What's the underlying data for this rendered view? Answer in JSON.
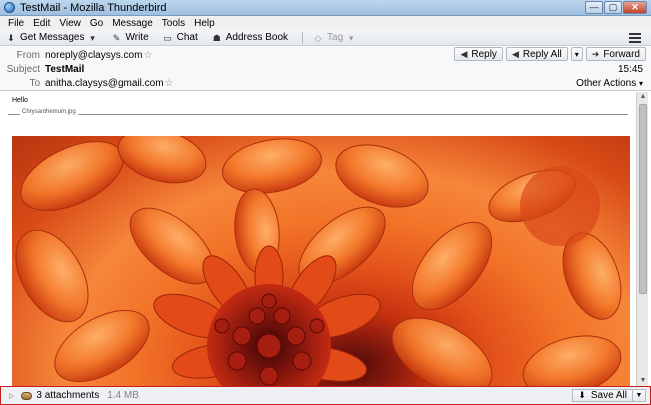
{
  "window": {
    "title": "TestMail - Mozilla Thunderbird",
    "minimize_glyph": "—",
    "maximize_glyph": "▢",
    "close_glyph": "✕"
  },
  "menu": [
    {
      "label": "File"
    },
    {
      "label": "Edit"
    },
    {
      "label": "View"
    },
    {
      "label": "Go"
    },
    {
      "label": "Message"
    },
    {
      "label": "Tools"
    },
    {
      "label": "Help"
    }
  ],
  "toolbar": {
    "get_messages": "Get Messages",
    "write": "Write",
    "chat": "Chat",
    "address_book": "Address Book",
    "tag": "Tag"
  },
  "header": {
    "from_label": "From",
    "from_value": "noreply@claysys.com",
    "subject_label": "Subject",
    "subject_value": "TestMail",
    "to_label": "To",
    "to_value": "anitha.claysys@gmail.com",
    "time": "15:45",
    "other_actions": "Other Actions",
    "reply": "Reply",
    "reply_all": "Reply All",
    "forward": "Forward"
  },
  "body": {
    "greeting": "Hello",
    "attachment_name": "Chrysanthemum.jpg"
  },
  "attachments": {
    "count_label": "3 attachments",
    "size": "1.4 MB",
    "save_all": "Save All"
  },
  "colors": {
    "attachbar_border": "#c42020",
    "flower_orange": "#f27328",
    "flower_center": "#4a0a08"
  }
}
